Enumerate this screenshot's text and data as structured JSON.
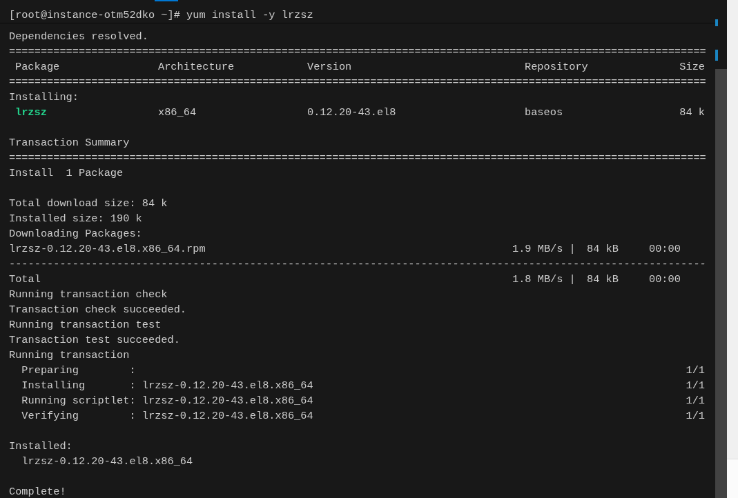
{
  "prompt": "[root@instance-otm52dko ~]# yum install -y lrzsz",
  "lines": [
    {
      "kind": "text",
      "text": "Dependencies resolved."
    },
    {
      "kind": "rule",
      "text": "=============================================================================================================="
    },
    {
      "kind": "header",
      "cells": [
        "Package",
        "Architecture",
        "Version",
        "Repository",
        "Size"
      ]
    },
    {
      "kind": "rule",
      "text": "=============================================================================================================="
    },
    {
      "kind": "text",
      "text": "Installing:"
    },
    {
      "kind": "package",
      "cells": [
        "lrzsz",
        "x86_64",
        "0.12.20-43.el8",
        "baseos",
        "84 k"
      ]
    },
    {
      "kind": "blank"
    },
    {
      "kind": "text",
      "text": "Transaction Summary"
    },
    {
      "kind": "rule",
      "text": "=============================================================================================================="
    },
    {
      "kind": "text",
      "text": "Install  1 Package"
    },
    {
      "kind": "blank"
    },
    {
      "kind": "text",
      "text": "Total download size: 84 k"
    },
    {
      "kind": "text",
      "text": "Installed size: 190 k"
    },
    {
      "kind": "text",
      "text": "Downloading Packages:"
    },
    {
      "kind": "download",
      "cells": [
        "lrzsz-0.12.20-43.el8.x86_64.rpm",
        "1.9 MB/s |",
        "84 kB",
        "00:00"
      ]
    },
    {
      "kind": "rule",
      "text": "--------------------------------------------------------------------------------------------------------------"
    },
    {
      "kind": "download",
      "cells": [
        "Total",
        "1.8 MB/s |",
        "84 kB",
        "00:00"
      ]
    },
    {
      "kind": "text",
      "text": "Running transaction check"
    },
    {
      "kind": "text",
      "text": "Transaction check succeeded."
    },
    {
      "kind": "text",
      "text": "Running transaction test"
    },
    {
      "kind": "text",
      "text": "Transaction test succeeded."
    },
    {
      "kind": "text",
      "text": "Running transaction"
    },
    {
      "kind": "step",
      "cells": [
        "  Preparing        :",
        "1/1"
      ]
    },
    {
      "kind": "step",
      "cells": [
        "  Installing       : lrzsz-0.12.20-43.el8.x86_64",
        "1/1"
      ]
    },
    {
      "kind": "step",
      "cells": [
        "  Running scriptlet: lrzsz-0.12.20-43.el8.x86_64",
        "1/1"
      ]
    },
    {
      "kind": "step",
      "cells": [
        "  Verifying        : lrzsz-0.12.20-43.el8.x86_64",
        "1/1"
      ]
    },
    {
      "kind": "blank"
    },
    {
      "kind": "text",
      "text": "Installed:"
    },
    {
      "kind": "text",
      "text": "  lrzsz-0.12.20-43.el8.x86_64"
    },
    {
      "kind": "blank"
    },
    {
      "kind": "text",
      "text": "Complete!"
    }
  ]
}
